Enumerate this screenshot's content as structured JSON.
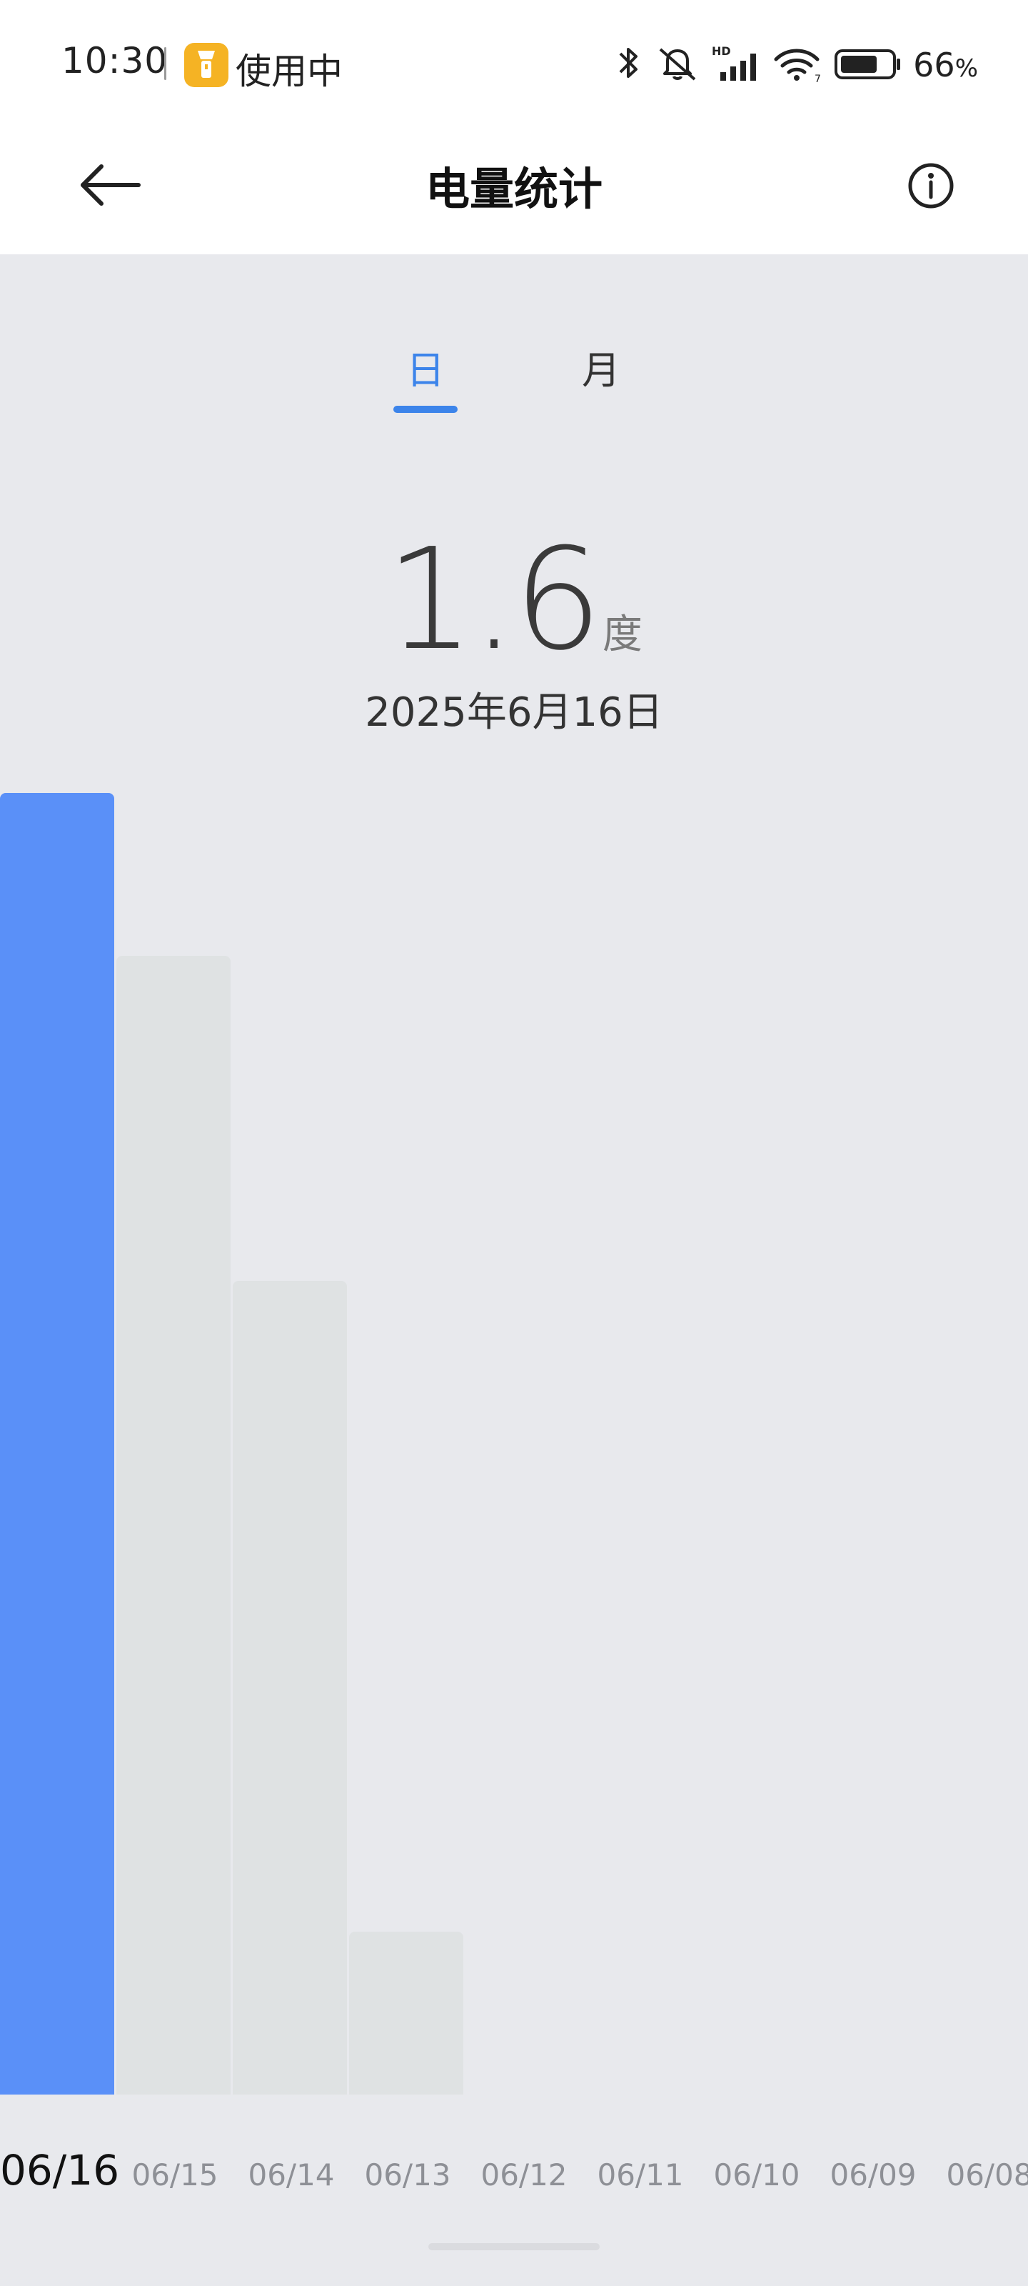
{
  "status_bar": {
    "time": "10:30",
    "app_status": "使用中",
    "battery_value": "66",
    "battery_unit": "%",
    "icons": [
      "flashlight-icon",
      "bluetooth-icon",
      "mute-icon",
      "hd-signal-icon",
      "wifi-icon",
      "battery-icon"
    ]
  },
  "header": {
    "title": "电量统计",
    "back_icon": "back-arrow-icon",
    "info_icon": "info-icon"
  },
  "tabs": [
    {
      "label": "日",
      "active": true
    },
    {
      "label": "月",
      "active": false
    }
  ],
  "summary": {
    "value": "1.6",
    "unit": "度",
    "date": "2025年6月16日"
  },
  "colors": {
    "accent": "#3C84EA",
    "active_bar": "#5A90F8",
    "inactive_bar": "#DFE2E3",
    "background": "#E8E9ED"
  },
  "chart_data": {
    "type": "bar",
    "categories": [
      "06/16",
      "06/15",
      "06/14",
      "06/13",
      "06/12",
      "06/11",
      "06/10",
      "06/09",
      "06/08"
    ],
    "values": [
      1.6,
      1.4,
      1.0,
      0.2,
      0,
      0,
      0,
      0,
      0
    ],
    "selected_index": 0
  }
}
